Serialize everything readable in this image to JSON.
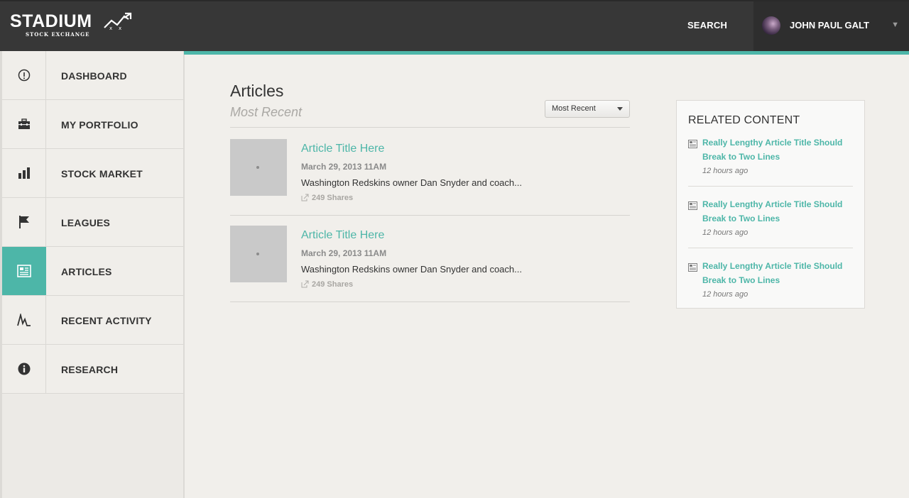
{
  "header": {
    "logo_text": "STADIUM",
    "logo_subtext": "STOCK EXCHANGE",
    "search_label": "SEARCH",
    "user_name": "JOHN PAUL GALT",
    "user_caret": "▼"
  },
  "sidebar": {
    "items": [
      {
        "label": "DASHBOARD",
        "icon": "dashboard-icon"
      },
      {
        "label": "MY PORTFOLIO",
        "icon": "briefcase-icon"
      },
      {
        "label": "STOCK MARKET",
        "icon": "bar-chart-icon"
      },
      {
        "label": "LEAGUES",
        "icon": "flag-icon"
      },
      {
        "label": "ARTICLES",
        "icon": "newspaper-icon",
        "active": true
      },
      {
        "label": "RECENT ACTIVITY",
        "icon": "activity-icon"
      },
      {
        "label": "RESEARCH",
        "icon": "info-icon"
      }
    ]
  },
  "main": {
    "title": "Articles",
    "subtitle": "Most Recent",
    "sort": {
      "selected": "Most Recent"
    },
    "articles": [
      {
        "title": "Article Title Here",
        "date": "March 29, 2013 11AM",
        "excerpt": "Washington Redskins owner Dan Snyder and coach...",
        "shares": "249 Shares"
      },
      {
        "title": "Article Title Here",
        "date": "March 29, 2013 11AM",
        "excerpt": "Washington Redskins owner Dan Snyder and coach...",
        "shares": "249 Shares"
      }
    ]
  },
  "related": {
    "heading": "RELATED CONTENT",
    "items": [
      {
        "title": "Really Lengthy Article Title Should Break to Two Lines",
        "time": "12 hours ago"
      },
      {
        "title": "Really Lengthy Article Title Should Break to Two Lines",
        "time": "12 hours ago"
      },
      {
        "title": "Really Lengthy Article Title Should Break to Two Lines",
        "time": "12 hours ago"
      }
    ]
  },
  "colors": {
    "accent": "#4db6a8",
    "topbar": "#373737",
    "background": "#f1efeb"
  }
}
